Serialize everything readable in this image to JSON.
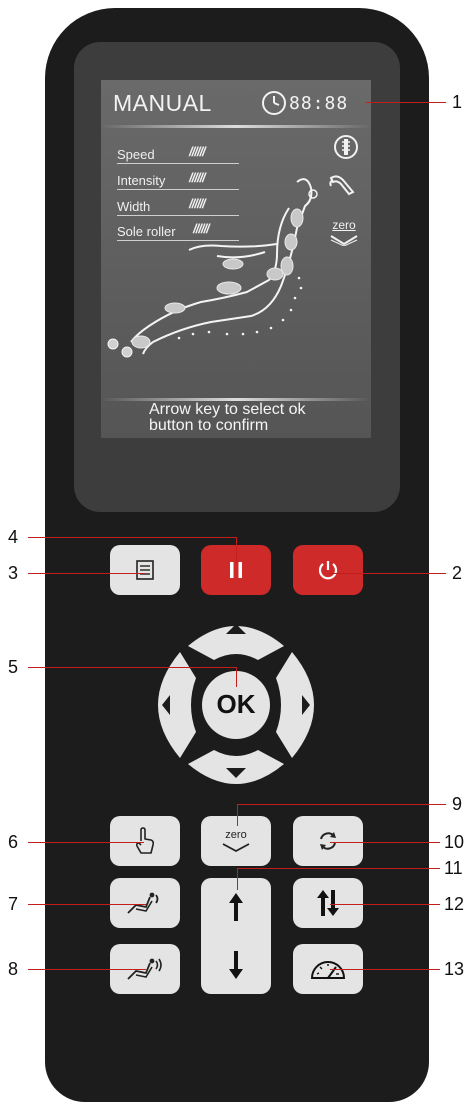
{
  "lcd": {
    "mode_title": "MANUAL",
    "time": "88:88",
    "params": [
      {
        "label": "Speed",
        "bars": "//////"
      },
      {
        "label": "Intensity",
        "bars": "//////"
      },
      {
        "label": "Width",
        "bars": "//////"
      },
      {
        "label": "Sole roller",
        "bars": "//////"
      }
    ],
    "side_icons": [
      "spine-icon",
      "hand-massage-icon",
      "zero-gravity-icon"
    ],
    "zero_label": "zero",
    "message_line1": "Arrow key to select ok",
    "message_line2": "button to confirm"
  },
  "buttons": {
    "ok_label": "OK",
    "zero_label": "zero"
  },
  "callouts": [
    "1",
    "2",
    "3",
    "4",
    "5",
    "6",
    "7",
    "8",
    "9",
    "10",
    "11",
    "12",
    "13"
  ],
  "colors": {
    "accent_red": "#cf2a2a",
    "body": "#1c1c1c",
    "button": "#e4e4e4"
  }
}
